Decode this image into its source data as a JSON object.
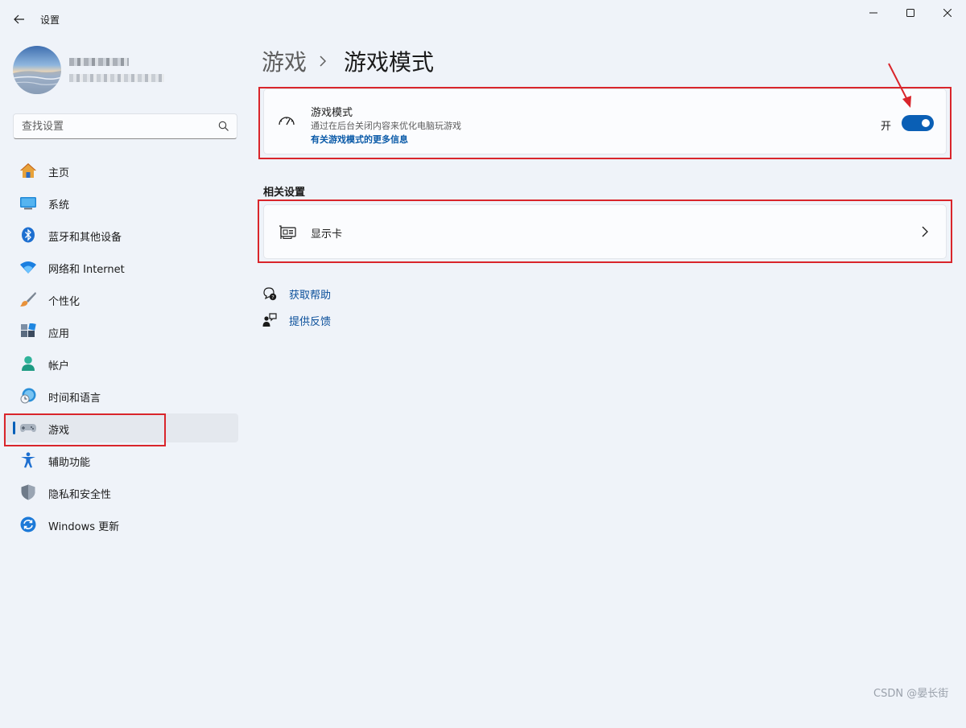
{
  "app": {
    "title": "设置"
  },
  "search": {
    "placeholder": "查找设置"
  },
  "sidebar": {
    "items": [
      {
        "label": "主页",
        "icon": "home-icon"
      },
      {
        "label": "系统",
        "icon": "system-icon"
      },
      {
        "label": "蓝牙和其他设备",
        "icon": "bluetooth-icon"
      },
      {
        "label": "网络和 Internet",
        "icon": "wifi-icon"
      },
      {
        "label": "个性化",
        "icon": "brush-icon"
      },
      {
        "label": "应用",
        "icon": "apps-icon"
      },
      {
        "label": "帐户",
        "icon": "account-icon"
      },
      {
        "label": "时间和语言",
        "icon": "time-language-icon"
      },
      {
        "label": "游戏",
        "icon": "gamepad-icon",
        "active": true
      },
      {
        "label": "辅助功能",
        "icon": "accessibility-icon"
      },
      {
        "label": "隐私和安全性",
        "icon": "shield-icon"
      },
      {
        "label": "Windows 更新",
        "icon": "windows-update-icon"
      }
    ]
  },
  "breadcrumb": {
    "parent": "游戏",
    "current": "游戏模式"
  },
  "game_mode": {
    "title": "游戏模式",
    "description": "通过在后台关闭内容来优化电脑玩游戏",
    "link": "有关游戏模式的更多信息",
    "toggle_label": "开",
    "toggle_on": true
  },
  "related": {
    "title": "相关设置",
    "items": [
      {
        "label": "显示卡"
      }
    ]
  },
  "help": {
    "get_help": "获取帮助",
    "feedback": "提供反馈"
  },
  "watermark": "CSDN @晏长街",
  "colors": {
    "accent": "#0a5fb5",
    "annotation": "#d9252b",
    "background": "#eff3f9"
  }
}
